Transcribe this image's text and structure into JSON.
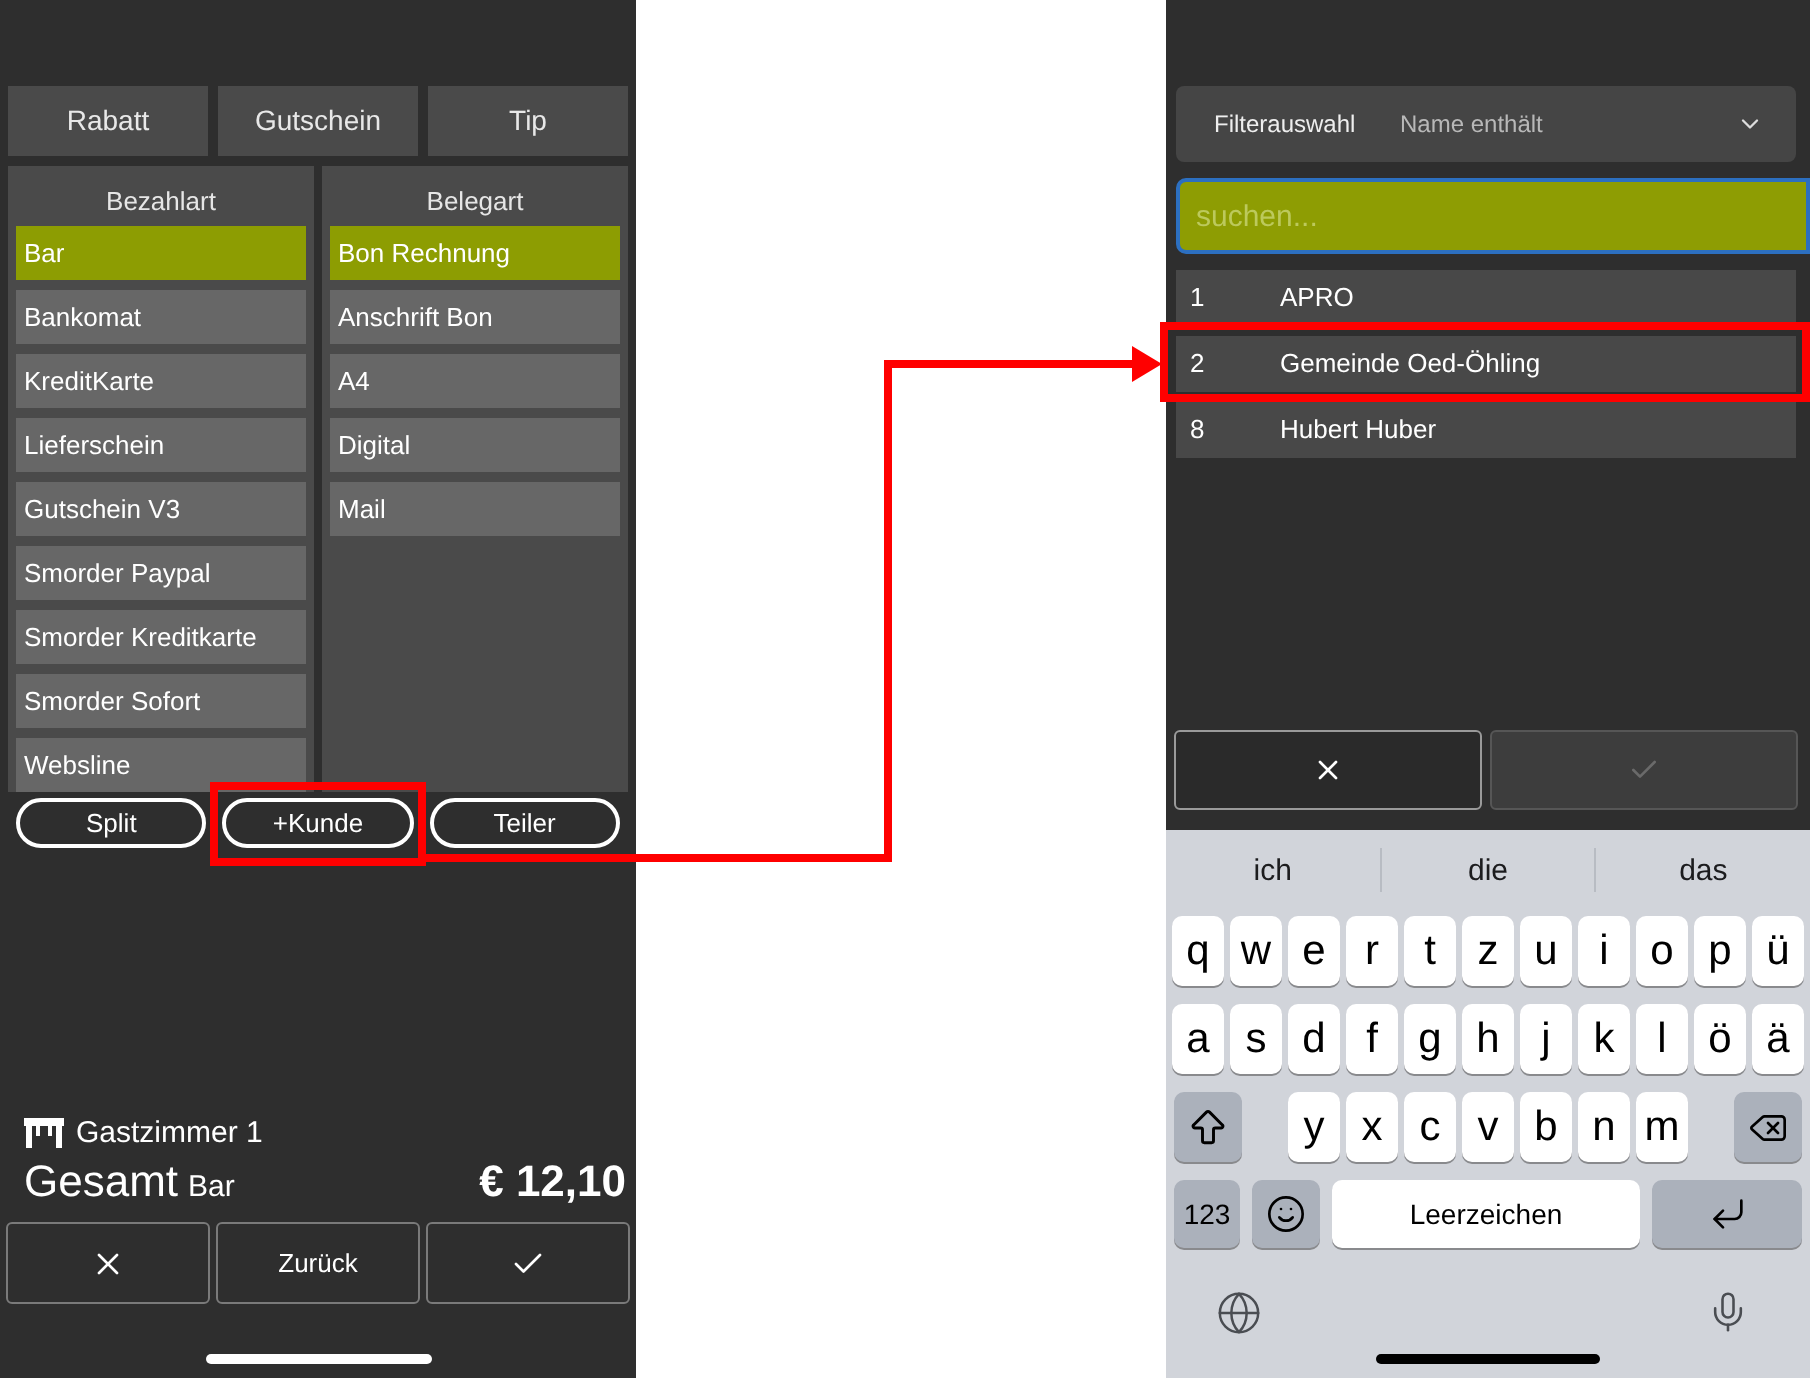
{
  "left_screen": {
    "top_buttons": [
      "Rabatt",
      "Gutschein",
      "Tip"
    ],
    "payment_panel": {
      "title": "Bezahlart",
      "items": [
        {
          "label": "Bar",
          "selected": true
        },
        {
          "label": "Bankomat",
          "selected": false
        },
        {
          "label": "KreditKarte",
          "selected": false
        },
        {
          "label": "Lieferschein",
          "selected": false
        },
        {
          "label": "Gutschein V3",
          "selected": false
        },
        {
          "label": "Smorder Paypal",
          "selected": false
        },
        {
          "label": "Smorder Kreditkarte",
          "selected": false
        },
        {
          "label": "Smorder Sofort",
          "selected": false
        },
        {
          "label": "Websline",
          "selected": false
        }
      ]
    },
    "receipt_panel": {
      "title": "Belegart",
      "items": [
        {
          "label": "Bon Rechnung",
          "selected": true
        },
        {
          "label": "Anschrift Bon",
          "selected": false
        },
        {
          "label": "A4",
          "selected": false
        },
        {
          "label": "Digital",
          "selected": false
        },
        {
          "label": "Mail",
          "selected": false
        }
      ]
    },
    "pill_buttons": [
      {
        "label": "Split",
        "highlighted": false
      },
      {
        "label": "+Kunde",
        "highlighted": true
      },
      {
        "label": "Teiler",
        "highlighted": false
      }
    ],
    "location": "Gastzimmer 1",
    "total": {
      "label": "Gesamt",
      "payment_method": "Bar",
      "amount": "€ 12,10"
    },
    "bottom_buttons": [
      {
        "kind": "cancel"
      },
      {
        "kind": "text",
        "label": "Zurück"
      },
      {
        "kind": "confirm"
      }
    ]
  },
  "right_screen": {
    "filter": {
      "label": "Filterauswahl",
      "value": "Name enthält"
    },
    "search": {
      "placeholder": "suchen...",
      "focused": true
    },
    "customers": [
      {
        "number": "1",
        "name": "APRO",
        "highlighted": false
      },
      {
        "number": "2",
        "name": "Gemeinde Oed-Öhling",
        "highlighted": true
      },
      {
        "number": "8",
        "name": "Hubert Huber",
        "highlighted": false
      }
    ],
    "dialog_buttons": [
      {
        "kind": "cancel",
        "disabled": false
      },
      {
        "kind": "confirm",
        "disabled": true
      }
    ],
    "keyboard": {
      "suggestions": [
        "ich",
        "die",
        "das"
      ],
      "letter_rows": [
        [
          "q",
          "w",
          "e",
          "r",
          "t",
          "z",
          "u",
          "i",
          "o",
          "p",
          "ü"
        ],
        [
          "a",
          "s",
          "d",
          "f",
          "g",
          "h",
          "j",
          "k",
          "l",
          "ö",
          "ä"
        ],
        [
          "y",
          "x",
          "c",
          "v",
          "b",
          "n",
          "m"
        ]
      ],
      "numbers_key": "123",
      "space_key": "Leerzeichen"
    }
  }
}
